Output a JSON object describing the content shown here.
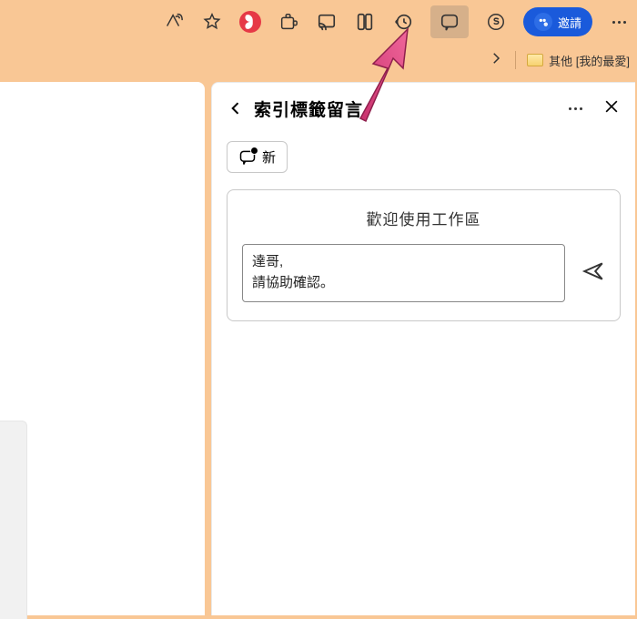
{
  "toolbar": {
    "invite_label": "邀請"
  },
  "bookmark_bar": {
    "folder_label": "其他 [我的最愛]"
  },
  "panel": {
    "title": "索引標籤留言",
    "new_label": "新",
    "compose_title": "歡迎使用工作區",
    "compose_value": "達哥,\n請協助確認。"
  }
}
